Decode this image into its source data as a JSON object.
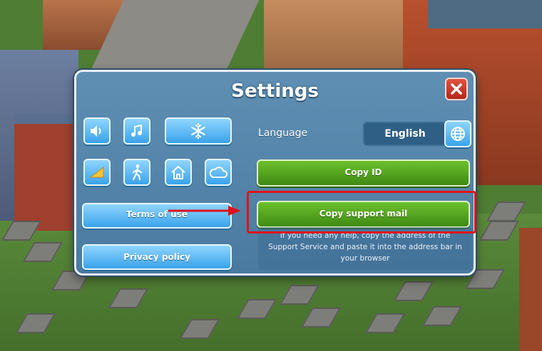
{
  "dialog": {
    "title": "Settings",
    "close": {
      "icon": "close-x-icon"
    },
    "toggles": [
      {
        "name": "sound",
        "icon": "speaker-icon"
      },
      {
        "name": "music",
        "icon": "music-note-icon"
      },
      {
        "name": "snow",
        "icon": "snowflake-icon"
      },
      {
        "name": "graphics",
        "icon": "quality-wedge-icon"
      },
      {
        "name": "walkers",
        "icon": "walking-person-icon"
      },
      {
        "name": "buildings",
        "icon": "house-icon"
      },
      {
        "name": "cloud",
        "icon": "cloud-icon"
      }
    ],
    "language": {
      "label": "Language",
      "value": "English",
      "icon": "globe-icon"
    },
    "buttons": {
      "terms": "Terms of use",
      "privacy": "Privacy policy",
      "copy_id": "Copy ID",
      "copy_mail": "Copy support mail"
    },
    "help_text": "If you need any help, copy the address of the Support Service and paste it into the address bar in your browser"
  },
  "colors": {
    "highlight": "#e0121b",
    "accent_blue": "#3aa3ea",
    "accent_green": "#4f9a1c"
  }
}
